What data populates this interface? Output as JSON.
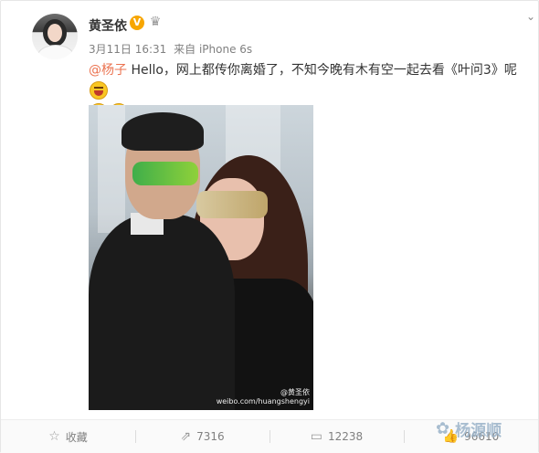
{
  "post": {
    "author": "黄圣依",
    "verified_badge": "V",
    "member_icon": "member-badge-icon",
    "date": "3月11日 16:31",
    "via": "来自 iPhone 6s",
    "text": {
      "mention": "@杨子",
      "part1": " Hello，网上都传你离婚了，不知今晚有木有空一起去看《叶问3》呢",
      "dots": "。。。"
    },
    "image_watermark": {
      "line1": "@黄圣依",
      "line2": "weibo.com/huangshengyi"
    }
  },
  "actions": {
    "favorite": {
      "icon": "star-icon",
      "label": "收藏"
    },
    "repost": {
      "icon": "repost-icon",
      "count": "7316"
    },
    "comment": {
      "icon": "comment-icon",
      "count": "12238"
    },
    "like": {
      "icon": "thumbs-up-icon",
      "count": "96610"
    }
  },
  "overlay_watermark": {
    "icon": "wechat-icon",
    "text": "杨源顺"
  },
  "colors": {
    "mention": "#eb7350",
    "verified": "#f7a600",
    "watermark": "#9ab3c9"
  }
}
